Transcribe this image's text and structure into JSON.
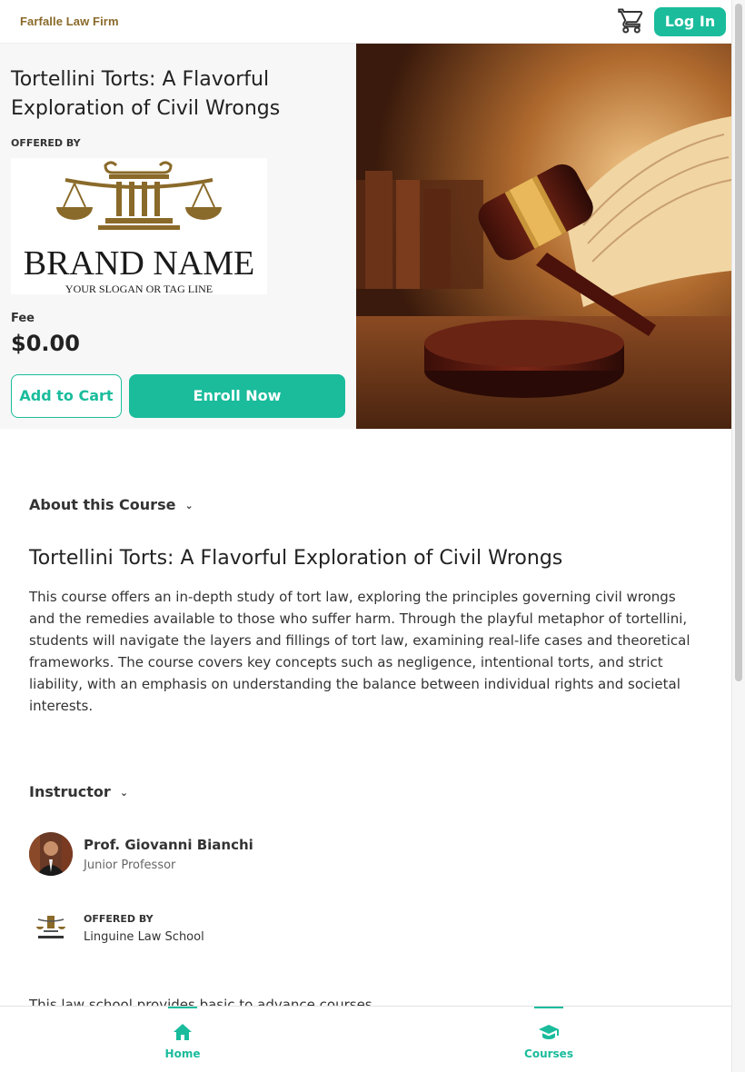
{
  "header": {
    "brand": "Farfalle Law Firm",
    "login_label": "Log In",
    "cart_icon": "shopping-cart-icon"
  },
  "course": {
    "title": "Tortellini Torts: A Flavorful Exploration of Civil Wrongs",
    "offered_by_label": "OFFERED BY",
    "fee_label": "Fee",
    "fee_value": "$0.00",
    "add_to_cart_label": "Add to Cart",
    "enroll_label": "Enroll Now",
    "logo": {
      "brand_name": "BRAND NAME",
      "slogan": "YOUR SLOGAN OR TAG LINE"
    },
    "hero_image": "gavel-and-book-photo"
  },
  "about": {
    "heading": "About this Course",
    "title": "Tortellini Torts: A Flavorful Exploration of Civil Wrongs",
    "description": "This course offers an in-depth study of tort law, exploring the principles governing civil wrongs and the remedies available to those who suffer harm. Through the playful metaphor of tortellini, students will navigate the layers and fillings of tort law, examining real-life cases and theoretical frameworks. The course covers key concepts such as negligence, intentional torts, and strict liability, with an emphasis on understanding the balance between individual rights and societal interests."
  },
  "instructor": {
    "heading": "Instructor",
    "name": "Prof. Giovanni Bianchi",
    "role": "Junior Professor",
    "offered_by_label": "OFFERED BY",
    "school_name": "Linguine Law School",
    "school_desc": "This law school provides basic to advance courses."
  },
  "nav": {
    "home_label": "Home",
    "courses_label": "Courses"
  },
  "colors": {
    "accent": "#1abc9c",
    "brand_gold": "#8a6a2a"
  }
}
